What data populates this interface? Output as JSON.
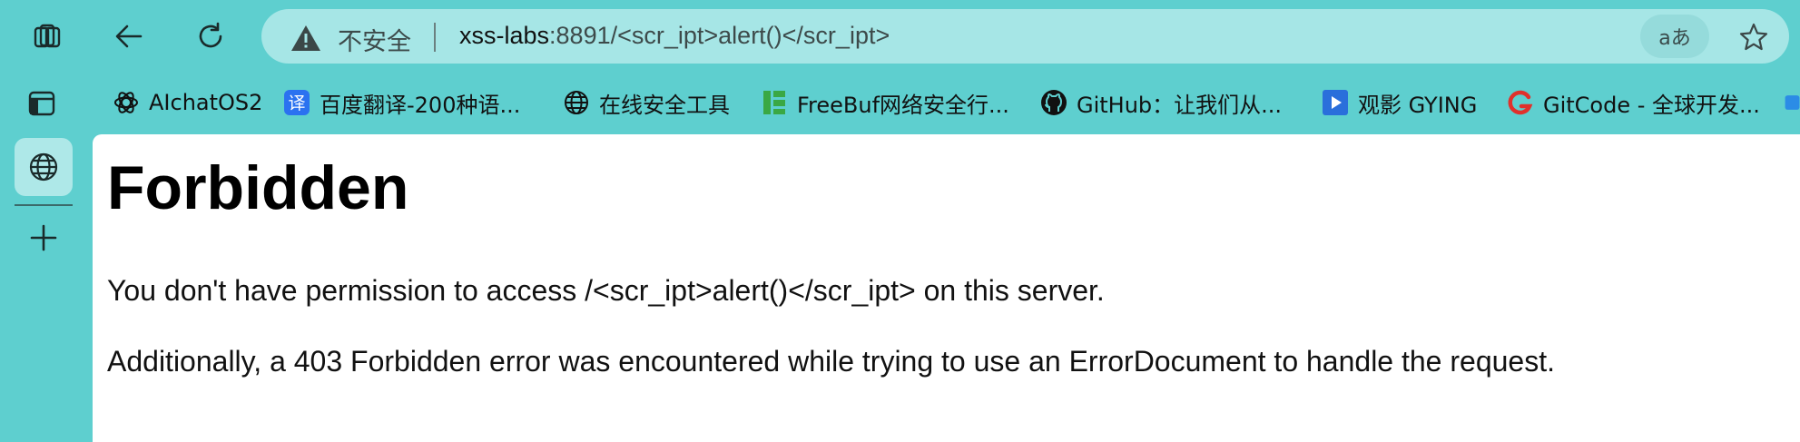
{
  "address_bar": {
    "security_label": "不安全",
    "url_host": "xss-labs",
    "url_rest": ":8891/<scr_ipt>alert()</scr_ipt>",
    "read_aloud_label": "aあ"
  },
  "bookmarks": [
    {
      "label": "AIchatOS2",
      "icon": "openai-icon"
    },
    {
      "label": "百度翻译-200种语...",
      "icon": "translate-icon"
    },
    {
      "label": "在线安全工具",
      "icon": "globe-icon"
    },
    {
      "label": "FreeBuf网络安全行...",
      "icon": "freebuf-icon"
    },
    {
      "label": "GitHub：让我们从...",
      "icon": "github-icon"
    },
    {
      "label": "观影 GYING",
      "icon": "play-icon"
    },
    {
      "label": "GitCode - 全球开发...",
      "icon": "gitcode-icon"
    }
  ],
  "page": {
    "title": "Forbidden",
    "message": "You don't have permission to access /<scr_ipt>alert()</scr_ipt> on this server.",
    "additional": "Additionally, a 403 Forbidden error was encountered while trying to use an ErrorDocument to handle the request."
  },
  "colors": {
    "chrome_bg": "#5ecfcf",
    "address_bg": "#a6e6e6",
    "page_bg": "#ffffff"
  }
}
